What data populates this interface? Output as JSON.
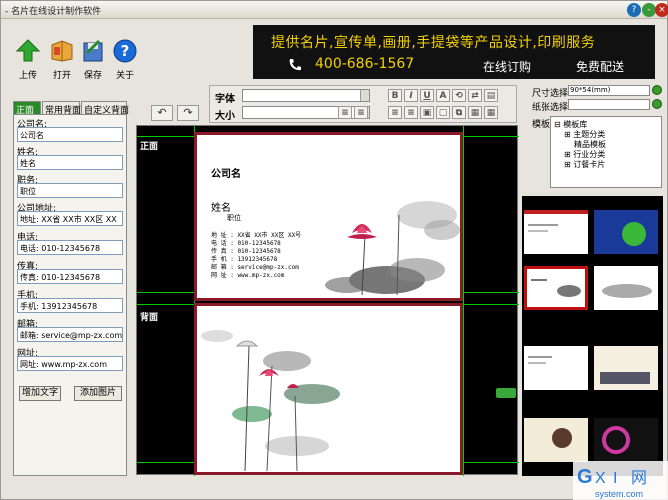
{
  "window": {
    "title": "- 名片在线设计制作软件"
  },
  "toolbar": {
    "upload": "上传",
    "open": "打开",
    "save": "保存",
    "about": "关于"
  },
  "banner": {
    "line1": "提供名片,宣传单,画册,手提袋等产品设计,印刷服务",
    "phone": "400-686-1567",
    "order": "在线订购",
    "delivery": "免费配送"
  },
  "tabs": [
    "正面",
    "常用背面",
    "自定义背面"
  ],
  "fields": [
    {
      "label": "公司名:",
      "value": "公司名"
    },
    {
      "label": "姓名:",
      "value": "姓名"
    },
    {
      "label": "职务:",
      "value": "职位"
    },
    {
      "label": "公司地址:",
      "value": "地址: XX省 XX市 XX区 XX"
    },
    {
      "label": "电话:",
      "value": "电话: 010-12345678"
    },
    {
      "label": "传真:",
      "value": "传真: 010-12345678"
    },
    {
      "label": "手机:",
      "value": "手机: 13912345678"
    },
    {
      "label": "邮箱:",
      "value": "邮箱: service@mp-zx.com"
    },
    {
      "label": "网址:",
      "value": "网址: www.mp-zx.com"
    }
  ],
  "buttons": {
    "add_text": "增加文字",
    "add_image": "添加图片"
  },
  "font_toolbar": {
    "font_label": "字体",
    "size_label": "大小"
  },
  "canvas": {
    "front_label": "正面",
    "back_label": "背面",
    "card": {
      "company": "公司名",
      "name": "姓名",
      "title": "职位",
      "lines": [
        "地 址 : XX省 XX市 XX区 XX号",
        "电 话 : 010-12345678",
        "传 真 : 010-12345678",
        "手 机 : 13912345678",
        "邮 箱 : service@mp-zx.com",
        "网 址 : www.mp-zx.com"
      ]
    }
  },
  "right": {
    "size_label": "尺寸选择",
    "size_value": "90*54(mm)",
    "paper_label": "纸张选择",
    "template_label": "模板",
    "tree": [
      "模板库",
      "主题分类",
      "精品模板",
      "行业分类",
      "订餐卡片"
    ]
  },
  "colors": {
    "accent": "#2a8a2a",
    "banner_text": "#f2d100",
    "card_border": "#8a1a2a"
  }
}
